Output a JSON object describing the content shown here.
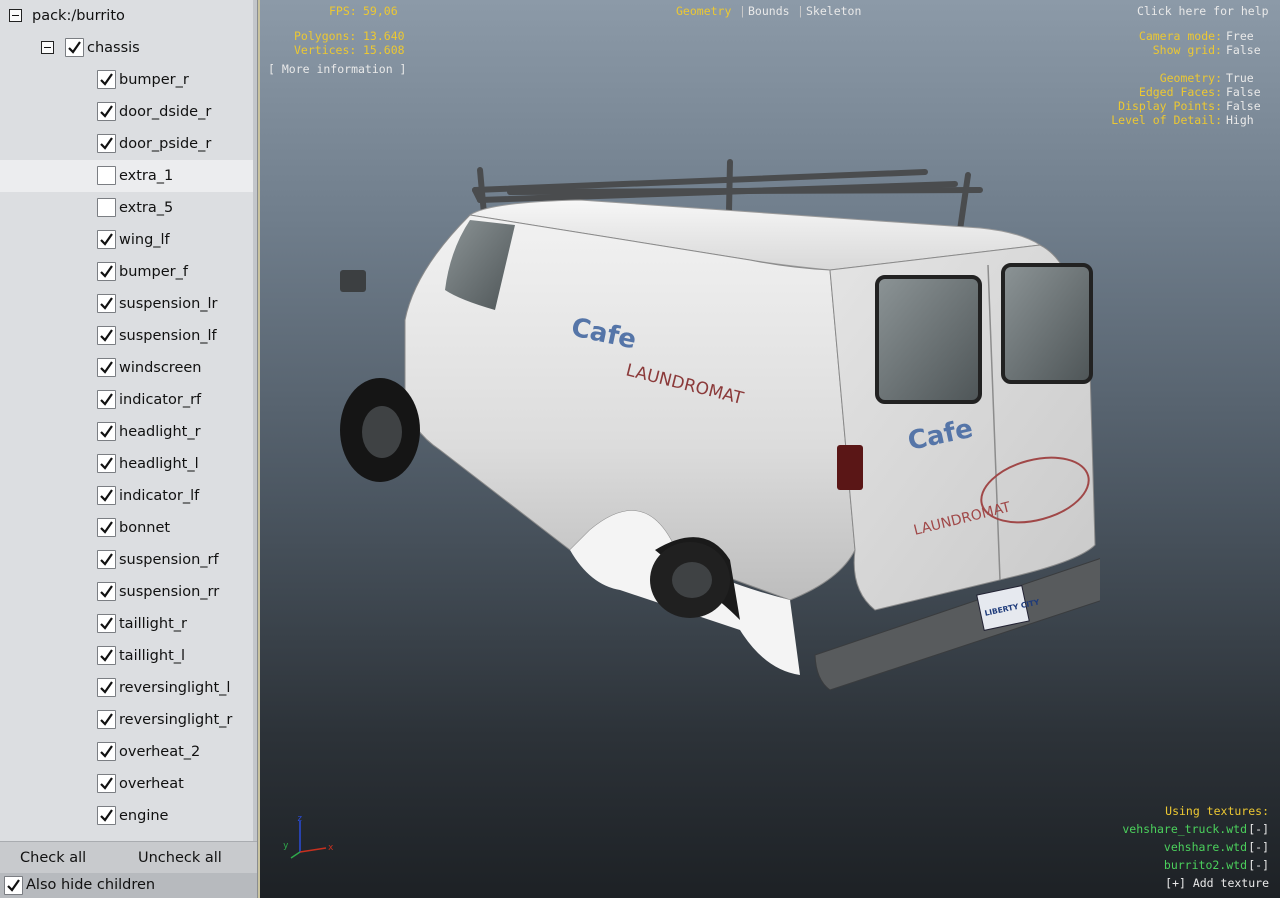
{
  "tree": {
    "root": {
      "label": "pack:/burrito"
    },
    "group": {
      "label": "chassis",
      "checked": true
    },
    "items": [
      {
        "label": "bumper_r",
        "checked": true
      },
      {
        "label": "door_dside_r",
        "checked": true
      },
      {
        "label": "door_pside_r",
        "checked": true
      },
      {
        "label": "extra_1",
        "checked": false,
        "selected": true
      },
      {
        "label": "extra_5",
        "checked": false
      },
      {
        "label": "wing_lf",
        "checked": true
      },
      {
        "label": "bumper_f",
        "checked": true
      },
      {
        "label": "suspension_lr",
        "checked": true
      },
      {
        "label": "suspension_lf",
        "checked": true
      },
      {
        "label": "windscreen",
        "checked": true
      },
      {
        "label": "indicator_rf",
        "checked": true
      },
      {
        "label": "headlight_r",
        "checked": true
      },
      {
        "label": "headlight_l",
        "checked": true
      },
      {
        "label": "indicator_lf",
        "checked": true
      },
      {
        "label": "bonnet",
        "checked": true
      },
      {
        "label": "suspension_rf",
        "checked": true
      },
      {
        "label": "suspension_rr",
        "checked": true
      },
      {
        "label": "taillight_r",
        "checked": true
      },
      {
        "label": "taillight_l",
        "checked": true
      },
      {
        "label": "reversinglight_l",
        "checked": true
      },
      {
        "label": "reversinglight_r",
        "checked": true
      },
      {
        "label": "overheat_2",
        "checked": true
      },
      {
        "label": "overheat",
        "checked": true
      },
      {
        "label": "engine",
        "checked": true
      }
    ]
  },
  "buttons": {
    "check_all": "Check all",
    "uncheck_all": "Uncheck all"
  },
  "also_hide_children": {
    "label": "Also hide children",
    "checked": true
  },
  "viewport": {
    "fps_label": "FPS:",
    "fps_value": "59,06",
    "modes": {
      "geometry": "Geometry",
      "sep1": "|",
      "bounds": "Bounds",
      "sep2": "|",
      "skeleton": "Skeleton"
    },
    "help": "Click here for help",
    "polygons_label": "Polygons:",
    "polygons_value": "13.640",
    "vertices_label": "Vertices:",
    "vertices_value": "15.608",
    "more_info": "[ More information ]",
    "settings": [
      {
        "label": "Camera mode:",
        "value": "Free"
      },
      {
        "label": "Show grid:",
        "value": "False"
      },
      {
        "label": "Geometry:",
        "value": "True"
      },
      {
        "label": "Edged Faces:",
        "value": "False"
      },
      {
        "label": "Display Points:",
        "value": "False"
      },
      {
        "label": "Level of Detail:",
        "value": "High"
      }
    ],
    "textures_title": "Using textures:",
    "textures": [
      {
        "name": "vehshare_truck.wtd",
        "action": "[-]"
      },
      {
        "name": "vehshare.wtd",
        "action": "[-]"
      },
      {
        "name": "burrito2.wtd",
        "action": "[-]"
      }
    ],
    "add_texture": "[+] Add texture",
    "axes": {
      "x": "x",
      "y": "y",
      "z": "z"
    },
    "van_text": {
      "brand": "LAUNDROMAT",
      "plate": "LIBERTY CITY"
    }
  },
  "colors": {
    "accent_yellow": "#ecc832",
    "texture_green": "#4bd05c",
    "text_light": "#e9e9e9"
  }
}
